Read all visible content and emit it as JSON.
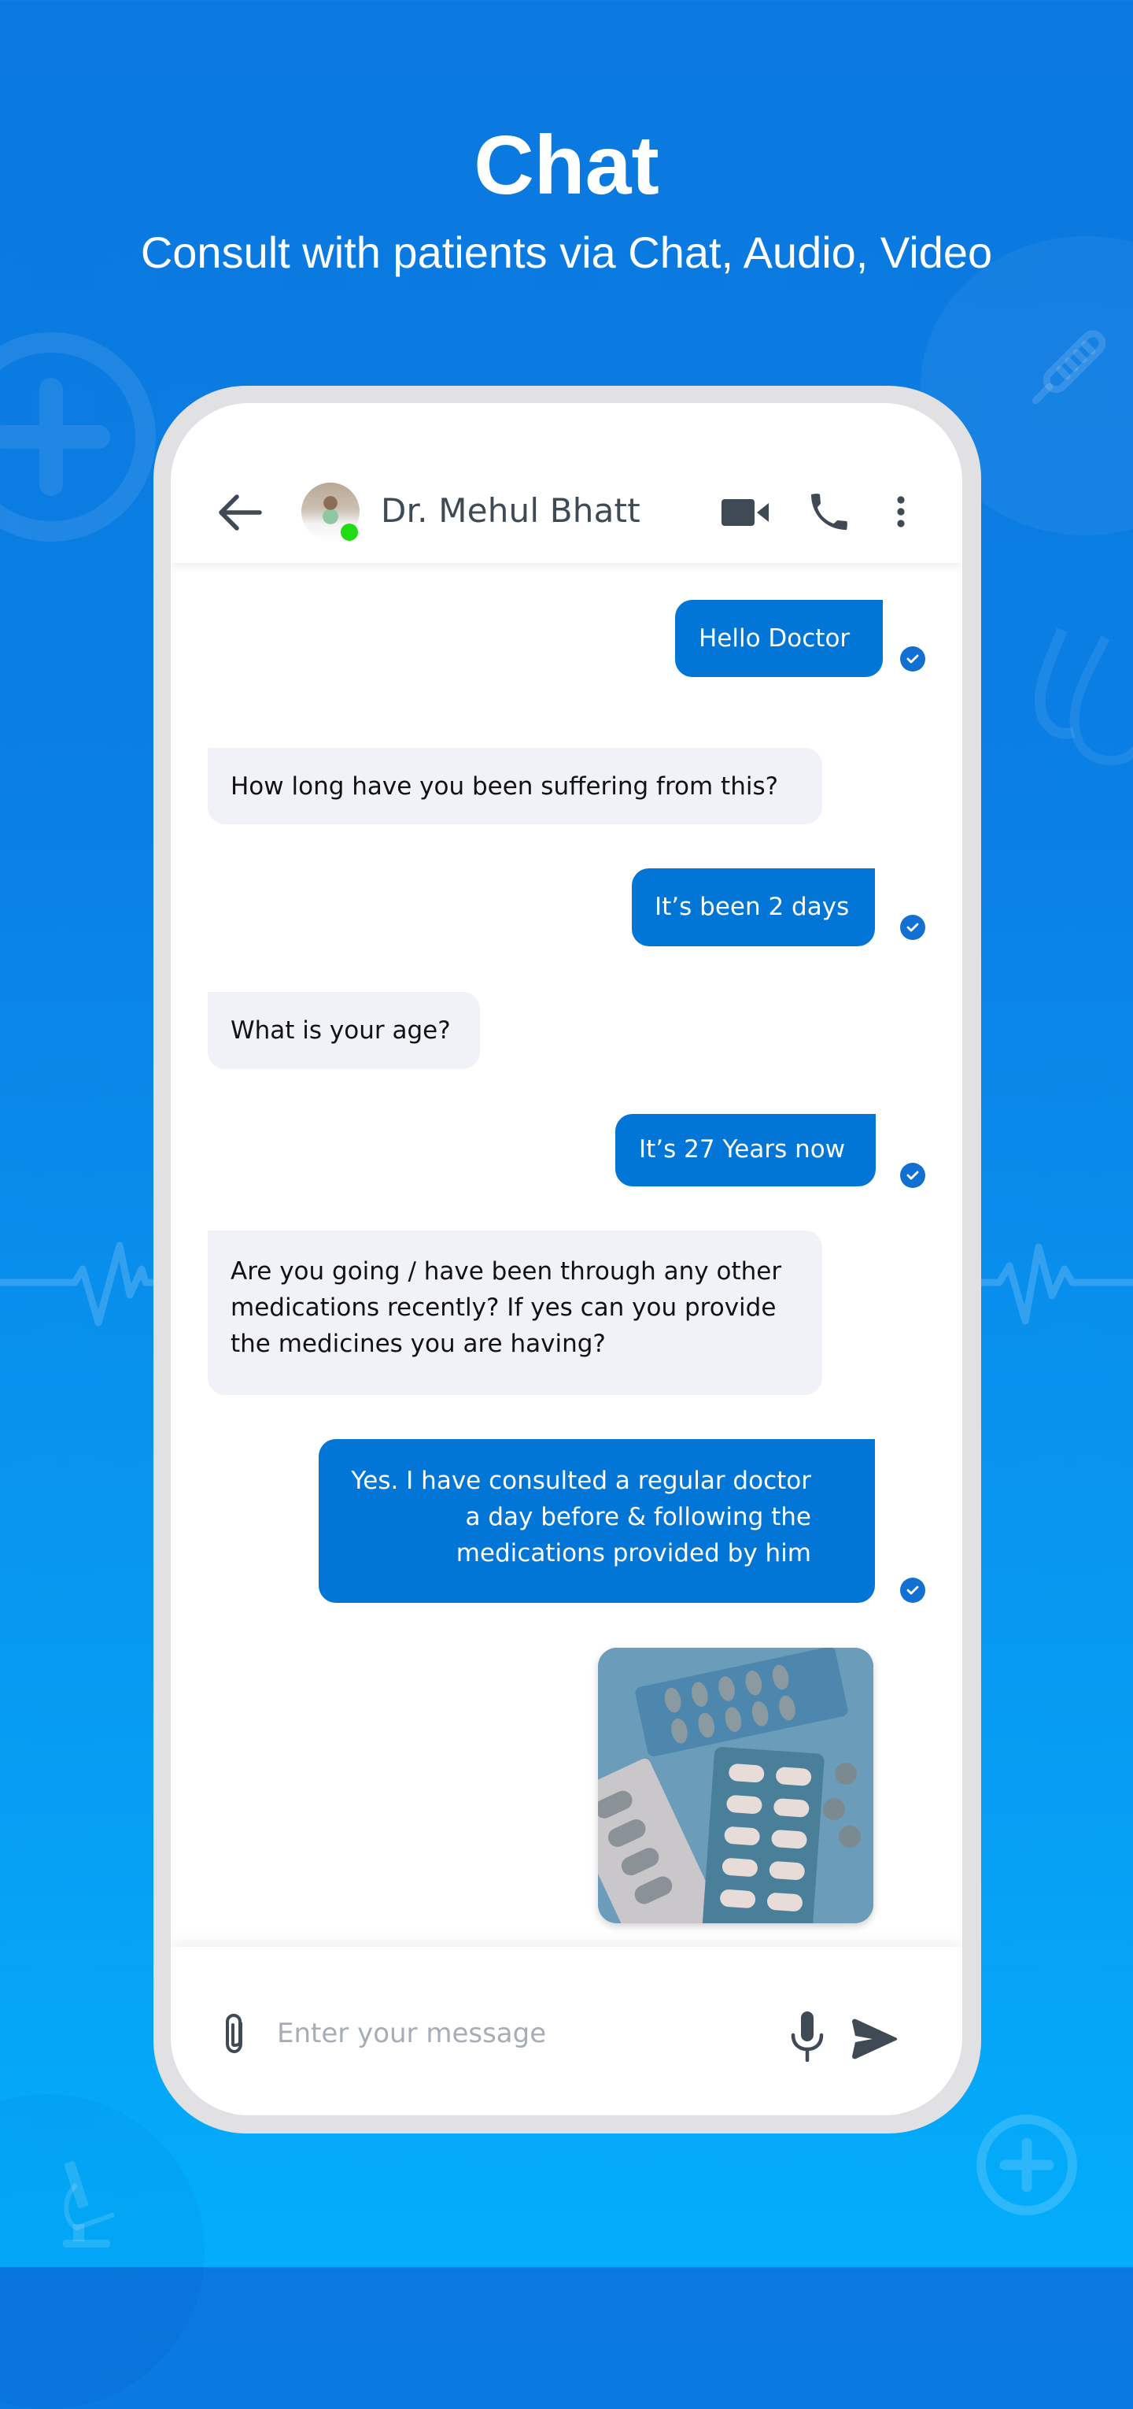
{
  "promo": {
    "title": "Chat",
    "subtitle": "Consult with patients via Chat, Audio, Video"
  },
  "header": {
    "contact_name": "Dr. Mehul Bhatt",
    "status": "online",
    "icons": [
      "back-arrow-icon",
      "video-call-icon",
      "phone-call-icon",
      "more-vertical-icon"
    ]
  },
  "messages": [
    {
      "side": "sent",
      "text": "Hello Doctor",
      "read": true
    },
    {
      "side": "received",
      "text": "How long have you been suffering from this?"
    },
    {
      "side": "sent",
      "text": "It’s been 2 days",
      "read": true
    },
    {
      "side": "received",
      "text": "What is your age?"
    },
    {
      "side": "sent",
      "text": "It’s 27 Years now",
      "read": true
    },
    {
      "side": "received",
      "text": "Are you going / have been through any other medications recently? If yes can you provide the medicines you are having?"
    },
    {
      "side": "sent",
      "text": "Yes. I have consulted a regular doctor a day before & following the medications provided by him",
      "read": true
    },
    {
      "side": "sent",
      "type": "image",
      "description": "Photo of medicine blister packs",
      "read": true
    }
  ],
  "input": {
    "placeholder": "Enter your message",
    "value": ""
  },
  "colors": {
    "sent_bubble": "#0276d6",
    "received_bubble": "#f0f2f8",
    "read_tick": "#1370d3",
    "online": "#1fdc13",
    "icon": "#3f4a55"
  }
}
